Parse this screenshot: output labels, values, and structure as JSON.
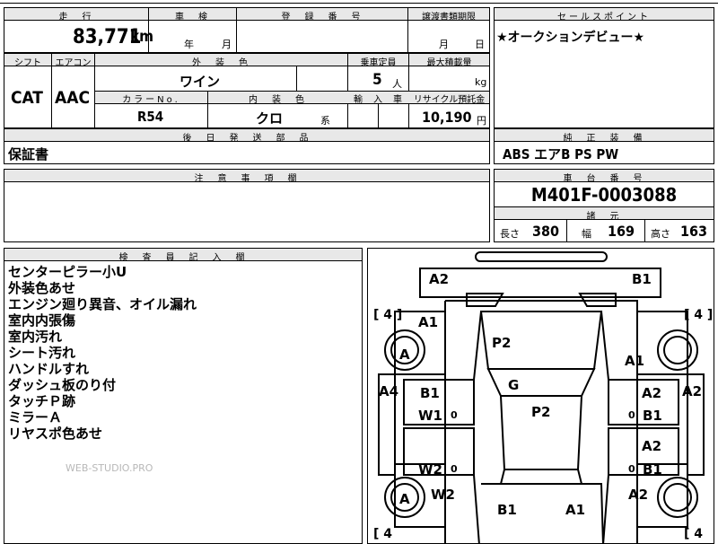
{
  "top": {
    "mileage_label": "走　行",
    "mileage_value": "83,771",
    "mileage_unit": "km",
    "inspection_label": "車　検",
    "inspection_year": "年",
    "inspection_month": "月",
    "reg_label": "登　録　番　号",
    "transfer_label": "譲渡書類期限",
    "transfer_month": "月",
    "transfer_day": "日",
    "sales_label": "セールスポイント",
    "sales_text": "★オークションデビュー★"
  },
  "row2": {
    "shift_label": "シフト",
    "shift_value": "CAT",
    "ac_label": "エアコン",
    "ac_value": "AAC",
    "exterior_label": "外　装　色",
    "exterior_value": "ワイン",
    "capacity_label": "乗車定員",
    "capacity_value": "5",
    "capacity_unit": "人",
    "load_label": "最大積載量",
    "load_unit": "kg",
    "color_no_label": "カラーNo.",
    "color_no_value": "R54",
    "interior_label": "内　装　色",
    "interior_value": "クロ",
    "interior_unit": "系",
    "import_label": "輸　入　車",
    "recycle_label": "リサイクル預託金",
    "recycle_value": "10,190",
    "recycle_unit": "円"
  },
  "accessories": {
    "label": "後　日　発　送　部　品",
    "value": "保証書"
  },
  "equipment": {
    "label": "純　正　装　備",
    "value": "ABS エアB PS PW"
  },
  "caution": {
    "label": "注　意　事　項　欄"
  },
  "chassis": {
    "label": "車　台　番　号",
    "value": "M401F-0003088"
  },
  "specs": {
    "label": "諸　元",
    "length_label": "長さ",
    "length_value": "380",
    "width_label": "幅",
    "width_value": "169",
    "height_label": "高さ",
    "height_value": "163"
  },
  "inspector": {
    "label": "検　査　員　記　入　欄",
    "notes": [
      "センターピラー小U",
      "外装色あせ",
      "エンジン廻り異音、オイル漏れ",
      "室内内張傷",
      "室内汚れ",
      "シート汚れ",
      "ハンドルすれ",
      "ダッシュ板のり付",
      "タッチＰ跡",
      "ミラーＡ",
      "リヤスポ色あせ"
    ],
    "watermark": "WEB-STUDIO.PRO"
  },
  "diagram": {
    "tire_left_top": "[ 4 ]",
    "tire_right_top": "[ 4 ]",
    "tire_left_bottom": "[ 4",
    "tire_right_bottom": "[ 4",
    "marks": {
      "a2_front_left": "A2",
      "b1_front_right": "B1",
      "a1_left": "A1",
      "a_front_left_wheel": "A",
      "p2_hood": "P2",
      "a1_right": "A1",
      "g_windshield": "G",
      "a4_left": "A4",
      "a2_right_side": "A2",
      "b1_left_door": "B1",
      "w1": "W1",
      "p2_roof": "P2",
      "a2_right_door": "A2",
      "b1_right_door": "B1",
      "a2_right_rear_door": "A2",
      "b1_right_rear_door": "B1",
      "w2_left_door": "W2",
      "w2_rear": "W2",
      "a_rear_left_wheel": "A",
      "b1_rear": "B1",
      "a1_rear": "A1",
      "a2_rear_right": "A2",
      "zero1": "0",
      "zero2": "0",
      "zero3": "0",
      "zero4": "0"
    }
  }
}
